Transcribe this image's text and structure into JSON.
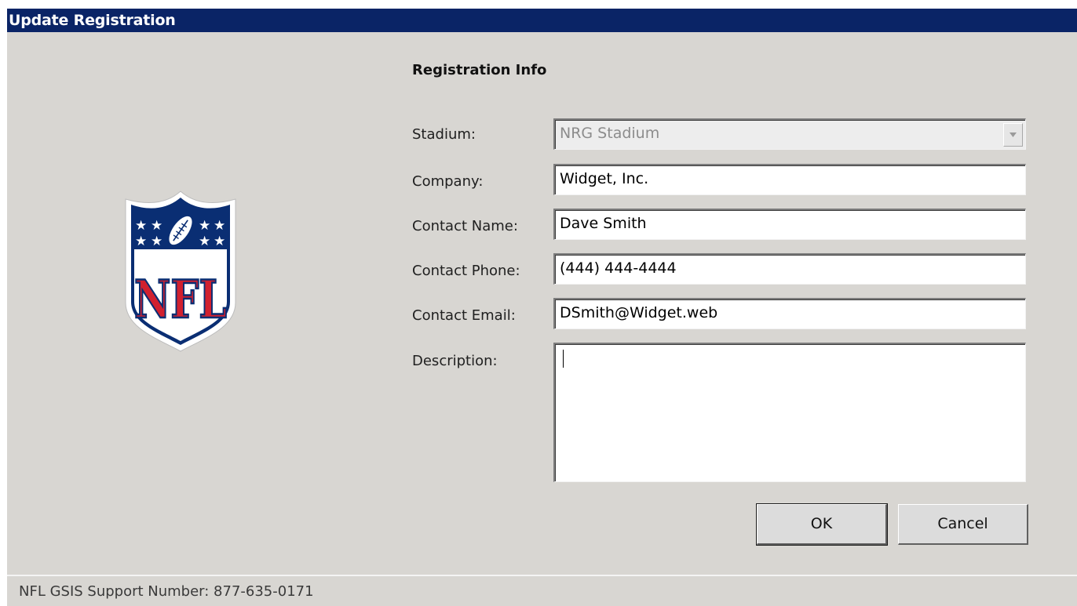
{
  "window": {
    "title": "Update Registration"
  },
  "logo": {
    "text": "NFL",
    "primary_color": "#0a2e73",
    "accent_color": "#d1202f"
  },
  "form": {
    "section_title": "Registration Info",
    "stadium": {
      "label": "Stadium:",
      "value": "NRG Stadium"
    },
    "company": {
      "label": "Company:",
      "value": "Widget, Inc."
    },
    "contact_name": {
      "label": "Contact Name:",
      "value": "Dave Smith"
    },
    "contact_phone": {
      "label": "Contact Phone:",
      "value": "(444) 444-4444"
    },
    "contact_email": {
      "label": "Contact Email:",
      "value": "DSmith@Widget.web"
    },
    "description": {
      "label": "Description:",
      "value": ""
    }
  },
  "buttons": {
    "ok": "OK",
    "cancel": "Cancel"
  },
  "footer": {
    "support_text": "NFL GSIS Support Number: 877-635-0171"
  }
}
